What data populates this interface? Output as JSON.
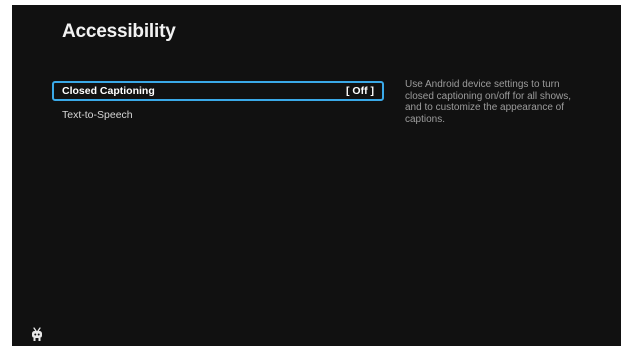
{
  "header": {
    "title": "Accessibility"
  },
  "menu": {
    "items": [
      {
        "label": "Closed Captioning",
        "value": "[ Off ]",
        "selected": true
      },
      {
        "label": "Text-to-Speech",
        "value": "",
        "selected": false
      }
    ]
  },
  "description": {
    "text": "Use Android device settings to turn closed captioning on/off for all shows, and to customize the appearance of captions."
  },
  "branding": {
    "logo_icon": "tivo-logo-icon"
  },
  "colors": {
    "background": "#111111",
    "focus_border": "#3aa9e8",
    "text_primary": "#ffffff",
    "text_secondary": "#9c9c9c"
  }
}
